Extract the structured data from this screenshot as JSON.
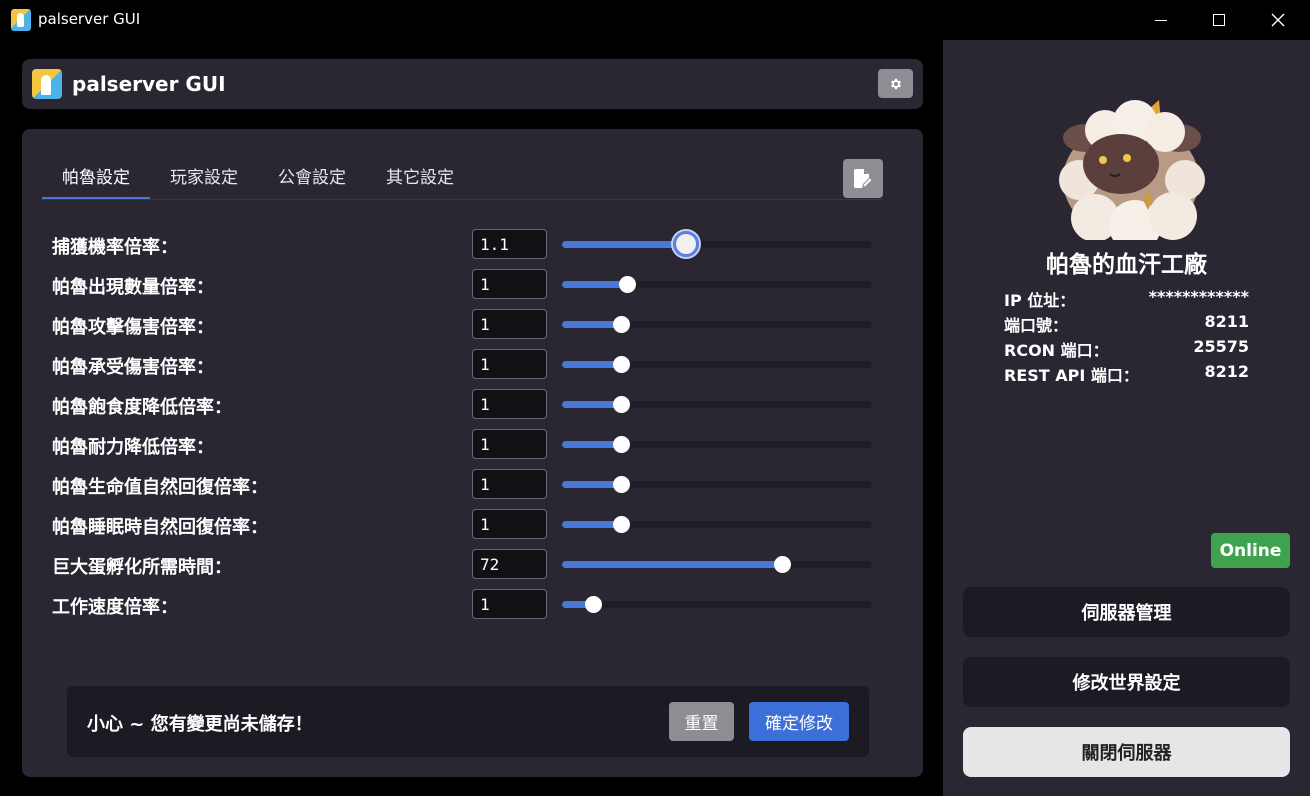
{
  "window": {
    "title": "palserver GUI",
    "controls": {
      "minimize": "minimize",
      "maximize": "maximize",
      "close": "close"
    }
  },
  "header": {
    "title": "palserver GUI"
  },
  "tabs": [
    {
      "label": "帕魯設定",
      "active": true
    },
    {
      "label": "玩家設定",
      "active": false
    },
    {
      "label": "公會設定",
      "active": false
    },
    {
      "label": "其它設定",
      "active": false
    }
  ],
  "settings": [
    {
      "label": "捕獲機率倍率：",
      "value": "1.1",
      "slider_fraction": 0.4
    },
    {
      "label": "帕魯出現數量倍率：",
      "value": "1",
      "slider_fraction": 0.21
    },
    {
      "label": "帕魯攻擊傷害倍率：",
      "value": "1",
      "slider_fraction": 0.19
    },
    {
      "label": "帕魯承受傷害倍率：",
      "value": "1",
      "slider_fraction": 0.19
    },
    {
      "label": "帕魯飽食度降低倍率：",
      "value": "1",
      "slider_fraction": 0.19
    },
    {
      "label": "帕魯耐力降低倍率：",
      "value": "1",
      "slider_fraction": 0.19
    },
    {
      "label": "帕魯生命值自然回復倍率：",
      "value": "1",
      "slider_fraction": 0.19
    },
    {
      "label": "帕魯睡眠時自然回復倍率：",
      "value": "1",
      "slider_fraction": 0.19
    },
    {
      "label": "巨大蛋孵化所需時間：",
      "value": "72",
      "slider_fraction": 0.71
    },
    {
      "label": "工作速度倍率：",
      "value": "1",
      "slider_fraction": 0.1
    }
  ],
  "notice": {
    "text": "小心 ~ 您有變更尚未儲存！",
    "reset_label": "重置",
    "confirm_label": "確定修改"
  },
  "server": {
    "name": "帕魯的血汗工廠",
    "info": [
      {
        "key": "IP 位址：",
        "value": "************"
      },
      {
        "key": "端口號：",
        "value": "8211"
      },
      {
        "key": "RCON 端口：",
        "value": "25575"
      },
      {
        "key": "REST API 端口：",
        "value": "8212"
      }
    ],
    "status": "Online",
    "buttons": [
      "伺服器管理",
      "修改世界設定",
      "關閉伺服器"
    ]
  },
  "colors": {
    "accent": "#4a78d8",
    "panel": "#2a2733",
    "online": "#3fa34d"
  },
  "icons": [
    "app-logo-icon",
    "gear-icon",
    "edit-document-icon",
    "pal-avatar-icon"
  ]
}
